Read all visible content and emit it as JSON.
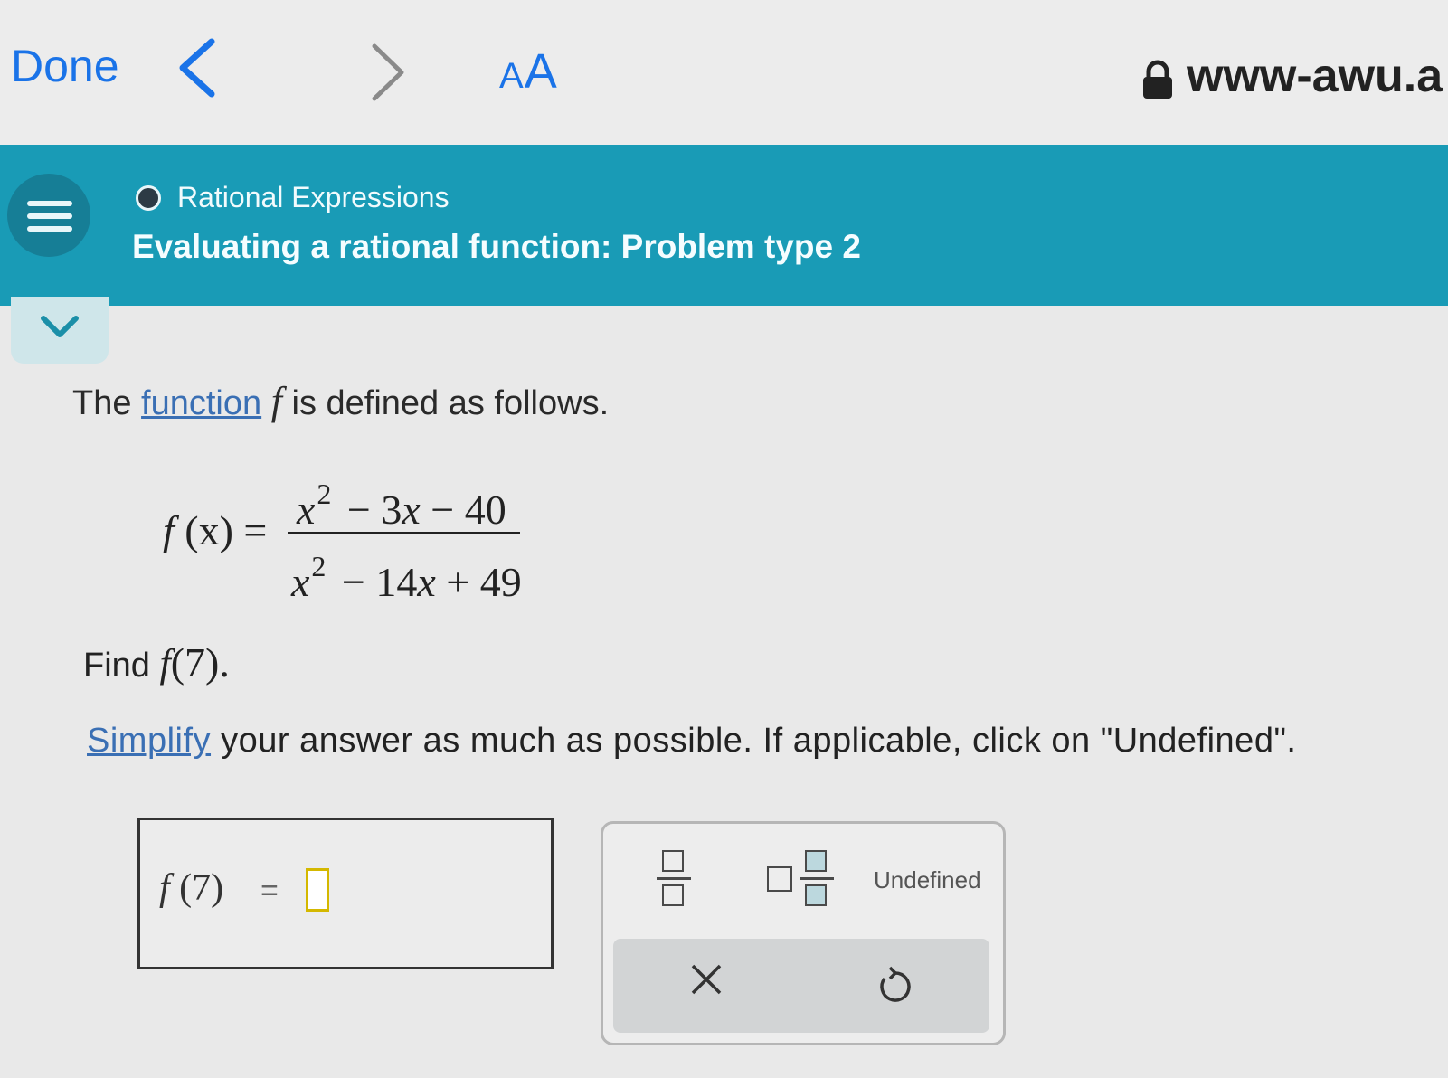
{
  "browser": {
    "done_label": "Done",
    "text_size_small": "A",
    "text_size_large": "A",
    "url": "www-awu.a",
    "icons": [
      "chevron-left-icon",
      "chevron-right-icon",
      "lock-icon"
    ],
    "link_color": "#1a73e8"
  },
  "header": {
    "topic": "Rational Expressions",
    "title": "Evaluating a rational function: Problem type 2",
    "color": "#199bb6"
  },
  "problem": {
    "stmt_prefix": "The",
    "function_link": "function",
    "fname": "f",
    "stmt_suffix": "is defined as follows.",
    "lhs_f": "f",
    "lhs_arg": "(x) =",
    "numerator": {
      "x": "x",
      "exp": "2",
      "rest1": "− 3",
      "x2": "x",
      "rest2": "− 40"
    },
    "denominator": {
      "x": "x",
      "exp": "2",
      "rest1": "− 14",
      "x2": "x",
      "rest2": "+ 49"
    },
    "find_label": "Find",
    "find_f": "f",
    "find_arg": "(7).",
    "simplify_link": "Simplify",
    "simplify_rest": "your answer as much as possible. If applicable, click on \"Undefined\"."
  },
  "answer": {
    "f": "f",
    "arg": "(7)",
    "eq": "=",
    "value": ""
  },
  "keypad": {
    "fraction_key": "fraction",
    "mixed_number_key": "mixed number",
    "undefined_label": "Undefined",
    "clear_key": "×",
    "undo_key": "undo"
  }
}
